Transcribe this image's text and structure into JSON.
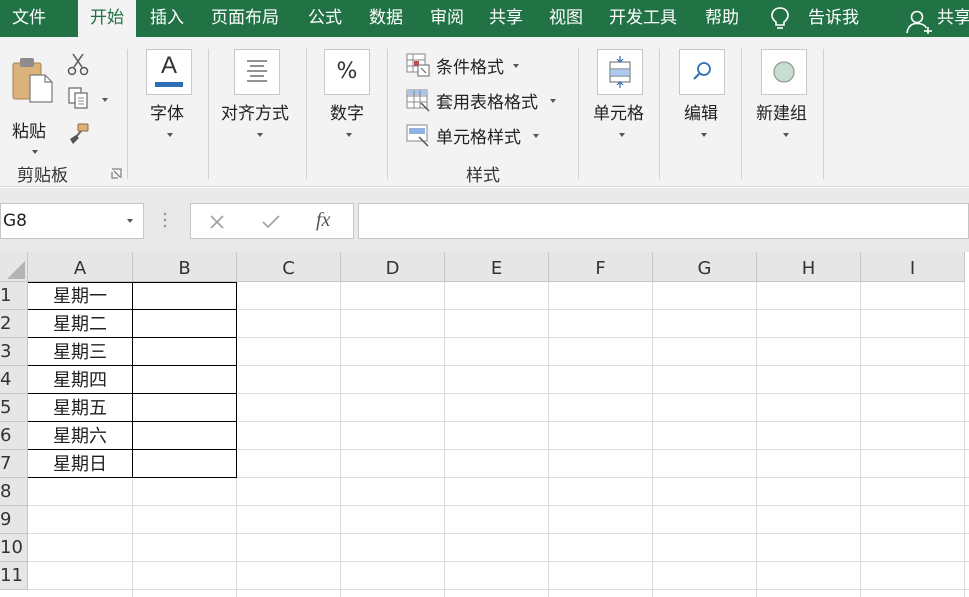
{
  "menu": {
    "tabs": [
      {
        "label": "文件"
      },
      {
        "label": "开始"
      },
      {
        "label": "插入"
      },
      {
        "label": "页面布局"
      },
      {
        "label": "公式"
      },
      {
        "label": "数据"
      },
      {
        "label": "审阅"
      },
      {
        "label": "共享"
      },
      {
        "label": "视图"
      },
      {
        "label": "开发工具"
      },
      {
        "label": "帮助"
      }
    ],
    "active_tab": "开始",
    "tell_me": "告诉我",
    "share": "共享"
  },
  "ribbon": {
    "clipboard": {
      "paste": "粘贴",
      "group": "剪贴板"
    },
    "font": {
      "label": "字体",
      "icon_letter": "A"
    },
    "alignment": {
      "label": "对齐方式"
    },
    "number": {
      "label": "数字",
      "icon_text": "%"
    },
    "styles": {
      "conditional_format": "条件格式",
      "table_format": "套用表格格式",
      "cell_styles": "单元格样式",
      "group": "样式"
    },
    "cells": {
      "label": "单元格"
    },
    "editing": {
      "label": "编辑"
    },
    "new_group": {
      "label": "新建组"
    }
  },
  "formula_bar": {
    "name_box": "G8",
    "fx": "fx",
    "value": ""
  },
  "sheet": {
    "columns": [
      "A",
      "B",
      "C",
      "D",
      "E",
      "F",
      "G",
      "H",
      "I"
    ],
    "rows": [
      "1",
      "2",
      "3",
      "4",
      "5",
      "6",
      "7",
      "8",
      "9",
      "10",
      "11"
    ],
    "column_a_values": [
      "星期一",
      "星期二",
      "星期三",
      "星期四",
      "星期五",
      "星期六",
      "星期日"
    ]
  },
  "colors": {
    "brand_green": "#217346",
    "ribbon_bg": "#f3f3f3",
    "header_bg": "#e6e6e6",
    "gridline": "#dcdcdc"
  }
}
